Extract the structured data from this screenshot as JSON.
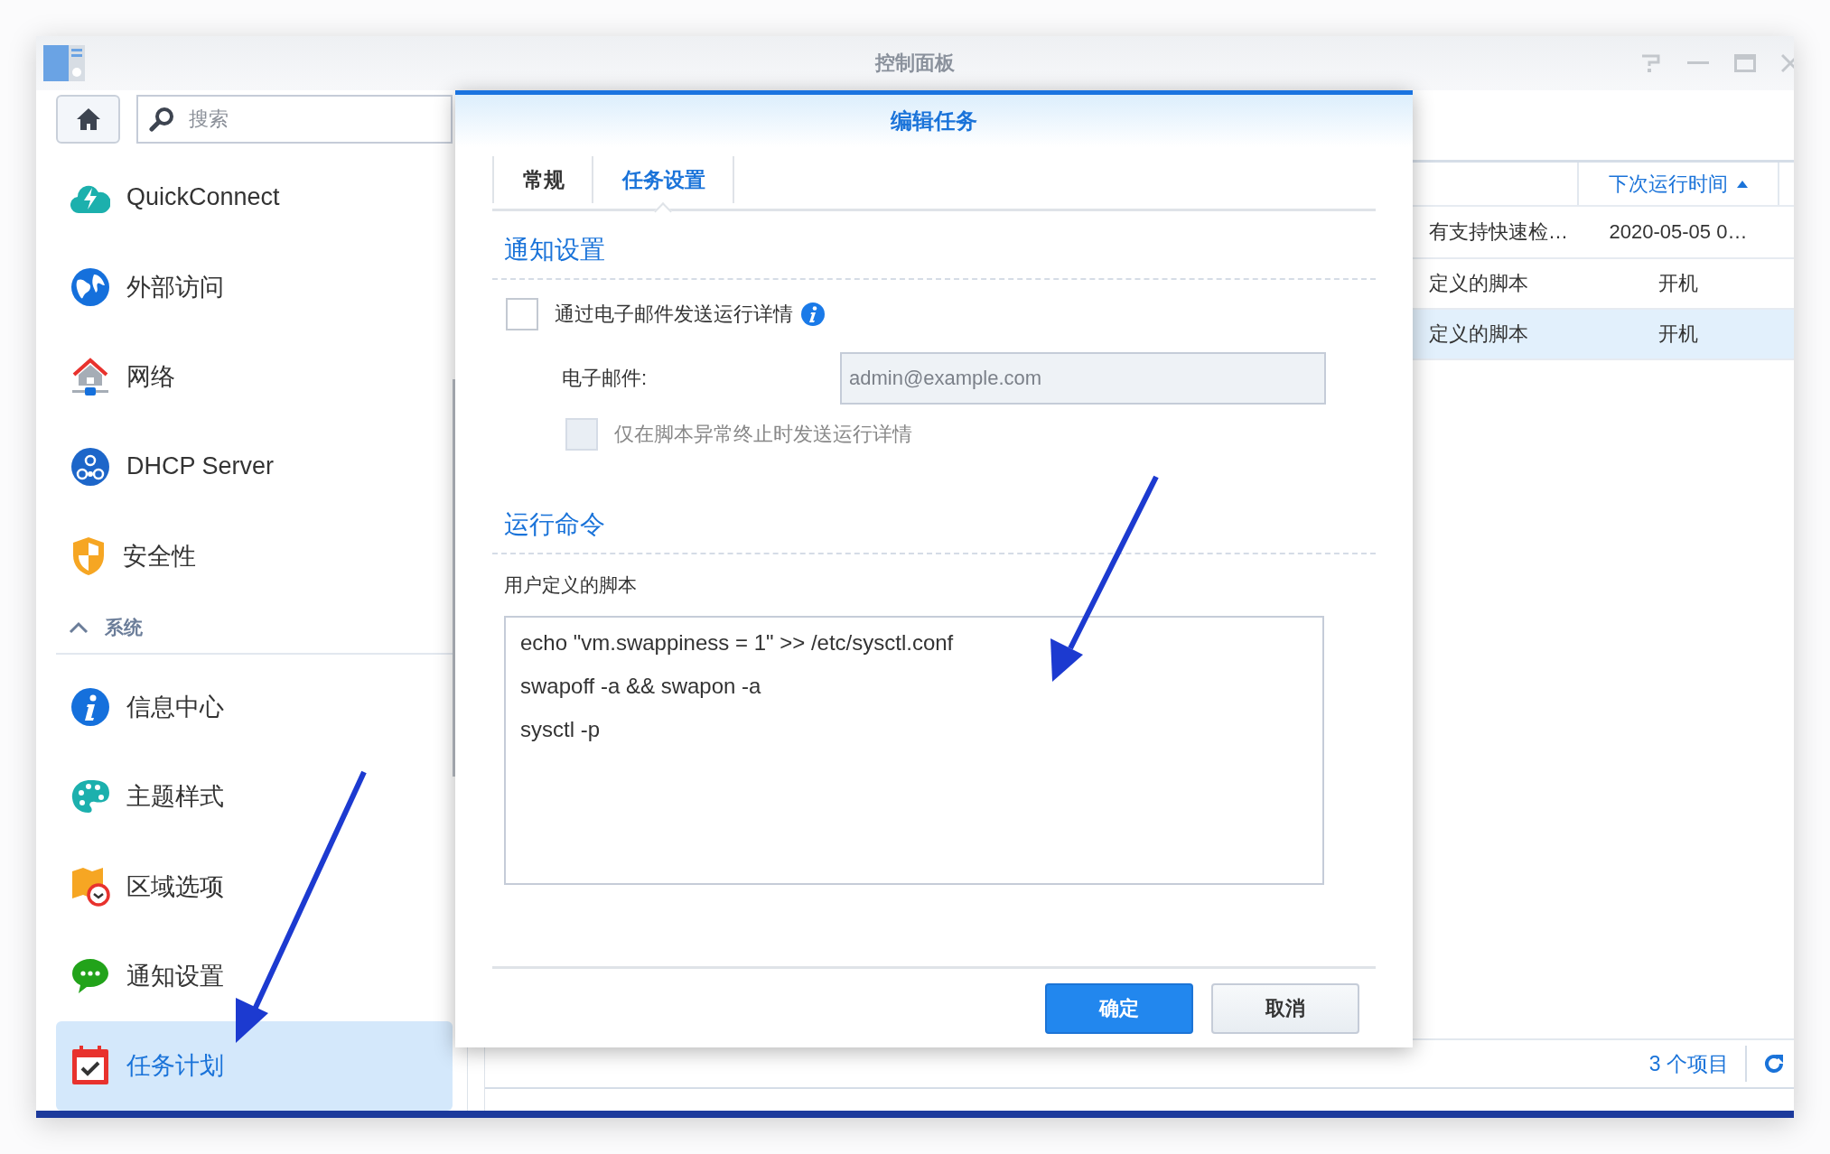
{
  "window": {
    "title": "控制面板"
  },
  "search": {
    "placeholder": "搜索"
  },
  "sidebar": {
    "groups": [
      {
        "items": [
          {
            "label": "QuickConnect",
            "selected": false
          },
          {
            "label": "外部访问",
            "selected": false
          },
          {
            "label": "网络",
            "selected": false
          },
          {
            "label": "DHCP Server",
            "selected": false
          },
          {
            "label": "安全性",
            "selected": false
          }
        ]
      },
      {
        "header": "系统",
        "expanded": true,
        "items": [
          {
            "label": "信息中心",
            "selected": false
          },
          {
            "label": "主题样式",
            "selected": false
          },
          {
            "label": "区域选项",
            "selected": false
          },
          {
            "label": "通知设置",
            "selected": false
          },
          {
            "label": "任务计划",
            "selected": true
          }
        ]
      }
    ]
  },
  "table": {
    "columns": [
      {},
      {
        "label": "下次运行时间",
        "sort_ascending": true
      }
    ],
    "rows": [
      {
        "cells": [
          "有支持快速检…",
          "2020-05-05 0…"
        ],
        "selected": false
      },
      {
        "cells": [
          "定义的脚本",
          "开机"
        ],
        "selected": false
      },
      {
        "cells": [
          "定义的脚本",
          "开机"
        ],
        "selected": true
      }
    ]
  },
  "status_bar": {
    "count": "3 个项目"
  },
  "dialog": {
    "title": "编辑任务",
    "tabs": [
      {
        "label": "常规",
        "selected": false
      },
      {
        "label": "任务设置",
        "selected": true
      }
    ],
    "notification": {
      "heading": "通知设置",
      "send_email": {
        "label": "通过电子邮件发送运行详情",
        "checked": false
      },
      "email": {
        "label": "电子邮件:",
        "placeholder": "admin@example.com",
        "disabled": true
      },
      "only_on_error": {
        "label": "仅在脚本异常终止时发送运行详情",
        "checked": false,
        "disabled": true
      }
    },
    "command": {
      "heading": "运行命令",
      "label": "用户定义的脚本",
      "script": "echo \"vm.swappiness = 1\" >> /etc/sysctl.conf\nswapoff -a && swapon -a\nsysctl -p"
    },
    "buttons": [
      {
        "label": "确定",
        "kind": "primary"
      },
      {
        "label": "取消",
        "kind": "secondary"
      }
    ]
  }
}
